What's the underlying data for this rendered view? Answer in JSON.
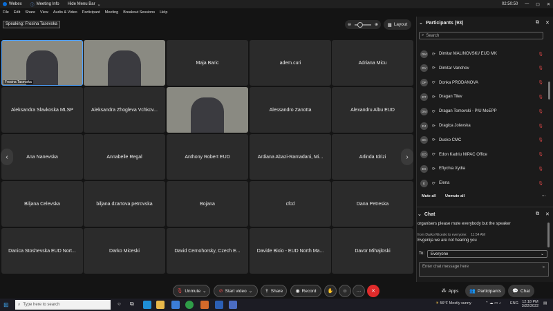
{
  "titlebar": {
    "app": "Webex",
    "meeting_info": "Meeting Info",
    "hide_menu": "Hide Menu Bar",
    "chevron": "⌄",
    "timer": "02:50:50"
  },
  "menu": [
    "File",
    "Edit",
    "Share",
    "View",
    "Audio & Video",
    "Participant",
    "Meeting",
    "Breakout Sessions",
    "Help"
  ],
  "stage": {
    "speaking": "Speaking: Frosina Tasevska",
    "layout": "Layout"
  },
  "tiles": [
    {
      "name": "Frosina Tasevska",
      "video": true,
      "row": 0,
      "col": 0
    },
    {
      "name": "",
      "video": true,
      "row": 0,
      "col": 1
    },
    {
      "name": "Maja Baric",
      "video": false,
      "row": 0,
      "col": 2
    },
    {
      "name": "adem.curi",
      "video": false,
      "row": 0,
      "col": 3
    },
    {
      "name": "Adriana Micu",
      "video": false,
      "row": 0,
      "col": 4
    },
    {
      "name": "Aleksandra Slavkoska MLSP",
      "video": false,
      "row": 1,
      "col": 0
    },
    {
      "name": "Aleksandra Zhogleva Vchkov...",
      "video": false,
      "row": 1,
      "col": 1
    },
    {
      "name": "",
      "video": true,
      "row": 1,
      "col": 2
    },
    {
      "name": "Alessandro Zanotta",
      "video": false,
      "row": 1,
      "col": 3
    },
    {
      "name": "Alexandru Albu EUD",
      "video": false,
      "row": 1,
      "col": 4
    },
    {
      "name": "Ana Nanevska",
      "video": false,
      "row": 2,
      "col": 0
    },
    {
      "name": "Annabelle Regal",
      "video": false,
      "row": 2,
      "col": 1
    },
    {
      "name": "Anthony Robert EUD",
      "video": false,
      "row": 2,
      "col": 2
    },
    {
      "name": "Ardiana Abazi-Ramadani, Mi...",
      "video": false,
      "row": 2,
      "col": 3
    },
    {
      "name": "Arlinda Idrizi",
      "video": false,
      "row": 2,
      "col": 4
    },
    {
      "name": "Biljana Celevska",
      "video": false,
      "row": 3,
      "col": 0
    },
    {
      "name": "biljana dzartova petrovska",
      "video": false,
      "row": 3,
      "col": 1
    },
    {
      "name": "Bojana",
      "video": false,
      "row": 3,
      "col": 2
    },
    {
      "name": "cfcd",
      "video": false,
      "row": 3,
      "col": 3
    },
    {
      "name": "Dana Petreska",
      "video": false,
      "row": 3,
      "col": 4
    },
    {
      "name": "Danica Stoshevska EUD Nort...",
      "video": false,
      "row": 4,
      "col": 0
    },
    {
      "name": "Darko Miceski",
      "video": false,
      "row": 4,
      "col": 1
    },
    {
      "name": "David Cernohorsky, Czech E...",
      "video": false,
      "row": 4,
      "col": 2
    },
    {
      "name": "Davide Bixio - EUD North Ma...",
      "video": false,
      "row": 4,
      "col": 3
    },
    {
      "name": "Davor Mihajloski",
      "video": false,
      "row": 4,
      "col": 4
    }
  ],
  "participants": {
    "title": "Participants (93)",
    "search_placeholder": "Search",
    "list": [
      {
        "initials": "DM",
        "name": "Dimitar MALINOVSKI/ EUD MK"
      },
      {
        "initials": "DV",
        "name": "Dimitar Vanchov"
      },
      {
        "initials": "DP",
        "name": "Donka PRODANOVA"
      },
      {
        "initials": "DT",
        "name": "Dragan Tilev"
      },
      {
        "initials": "DM",
        "name": "Dragan Tomovski - PIU MoEPP"
      },
      {
        "initials": "DJ",
        "name": "Dragica Jolevska"
      },
      {
        "initials": "DC",
        "name": "Dusko CMC"
      },
      {
        "initials": "EO",
        "name": "Edon Kadriu NIPAC Office"
      },
      {
        "initials": "EX",
        "name": "Eftychia Xydia"
      },
      {
        "initials": "E",
        "name": "Elena"
      }
    ],
    "mute_all": "Mute all",
    "unmute_all": "Unmute all",
    "more": "···"
  },
  "chat": {
    "title": "Chat",
    "msg1": "organisers please mute everybody but the speaker",
    "from": "from Darko Miceski to everyone:",
    "time": "11:54 AM",
    "msg2": "Evgenija we are not hearing you",
    "to_label": "To:",
    "to_value": "Everyone",
    "input_placeholder": "Enter chat message here"
  },
  "controls": {
    "unmute": "Unmute",
    "start_video": "Start video",
    "share": "Share",
    "record": "Record",
    "apps": "Apps",
    "participants": "Participants",
    "chat": "Chat",
    "more": "···"
  },
  "taskbar": {
    "search": "Type here to search",
    "weather": "56°F  Mostly sunny",
    "lang": "ENG",
    "time": "12:18 PM",
    "date": "3/22/2022"
  },
  "colors": {
    "accent": "#0b6dd6",
    "end_call": "#e02b2b",
    "mute_red": "#e04848",
    "panel_bg": "#1b1b1b",
    "tile_bg": "#2b2b2b"
  }
}
